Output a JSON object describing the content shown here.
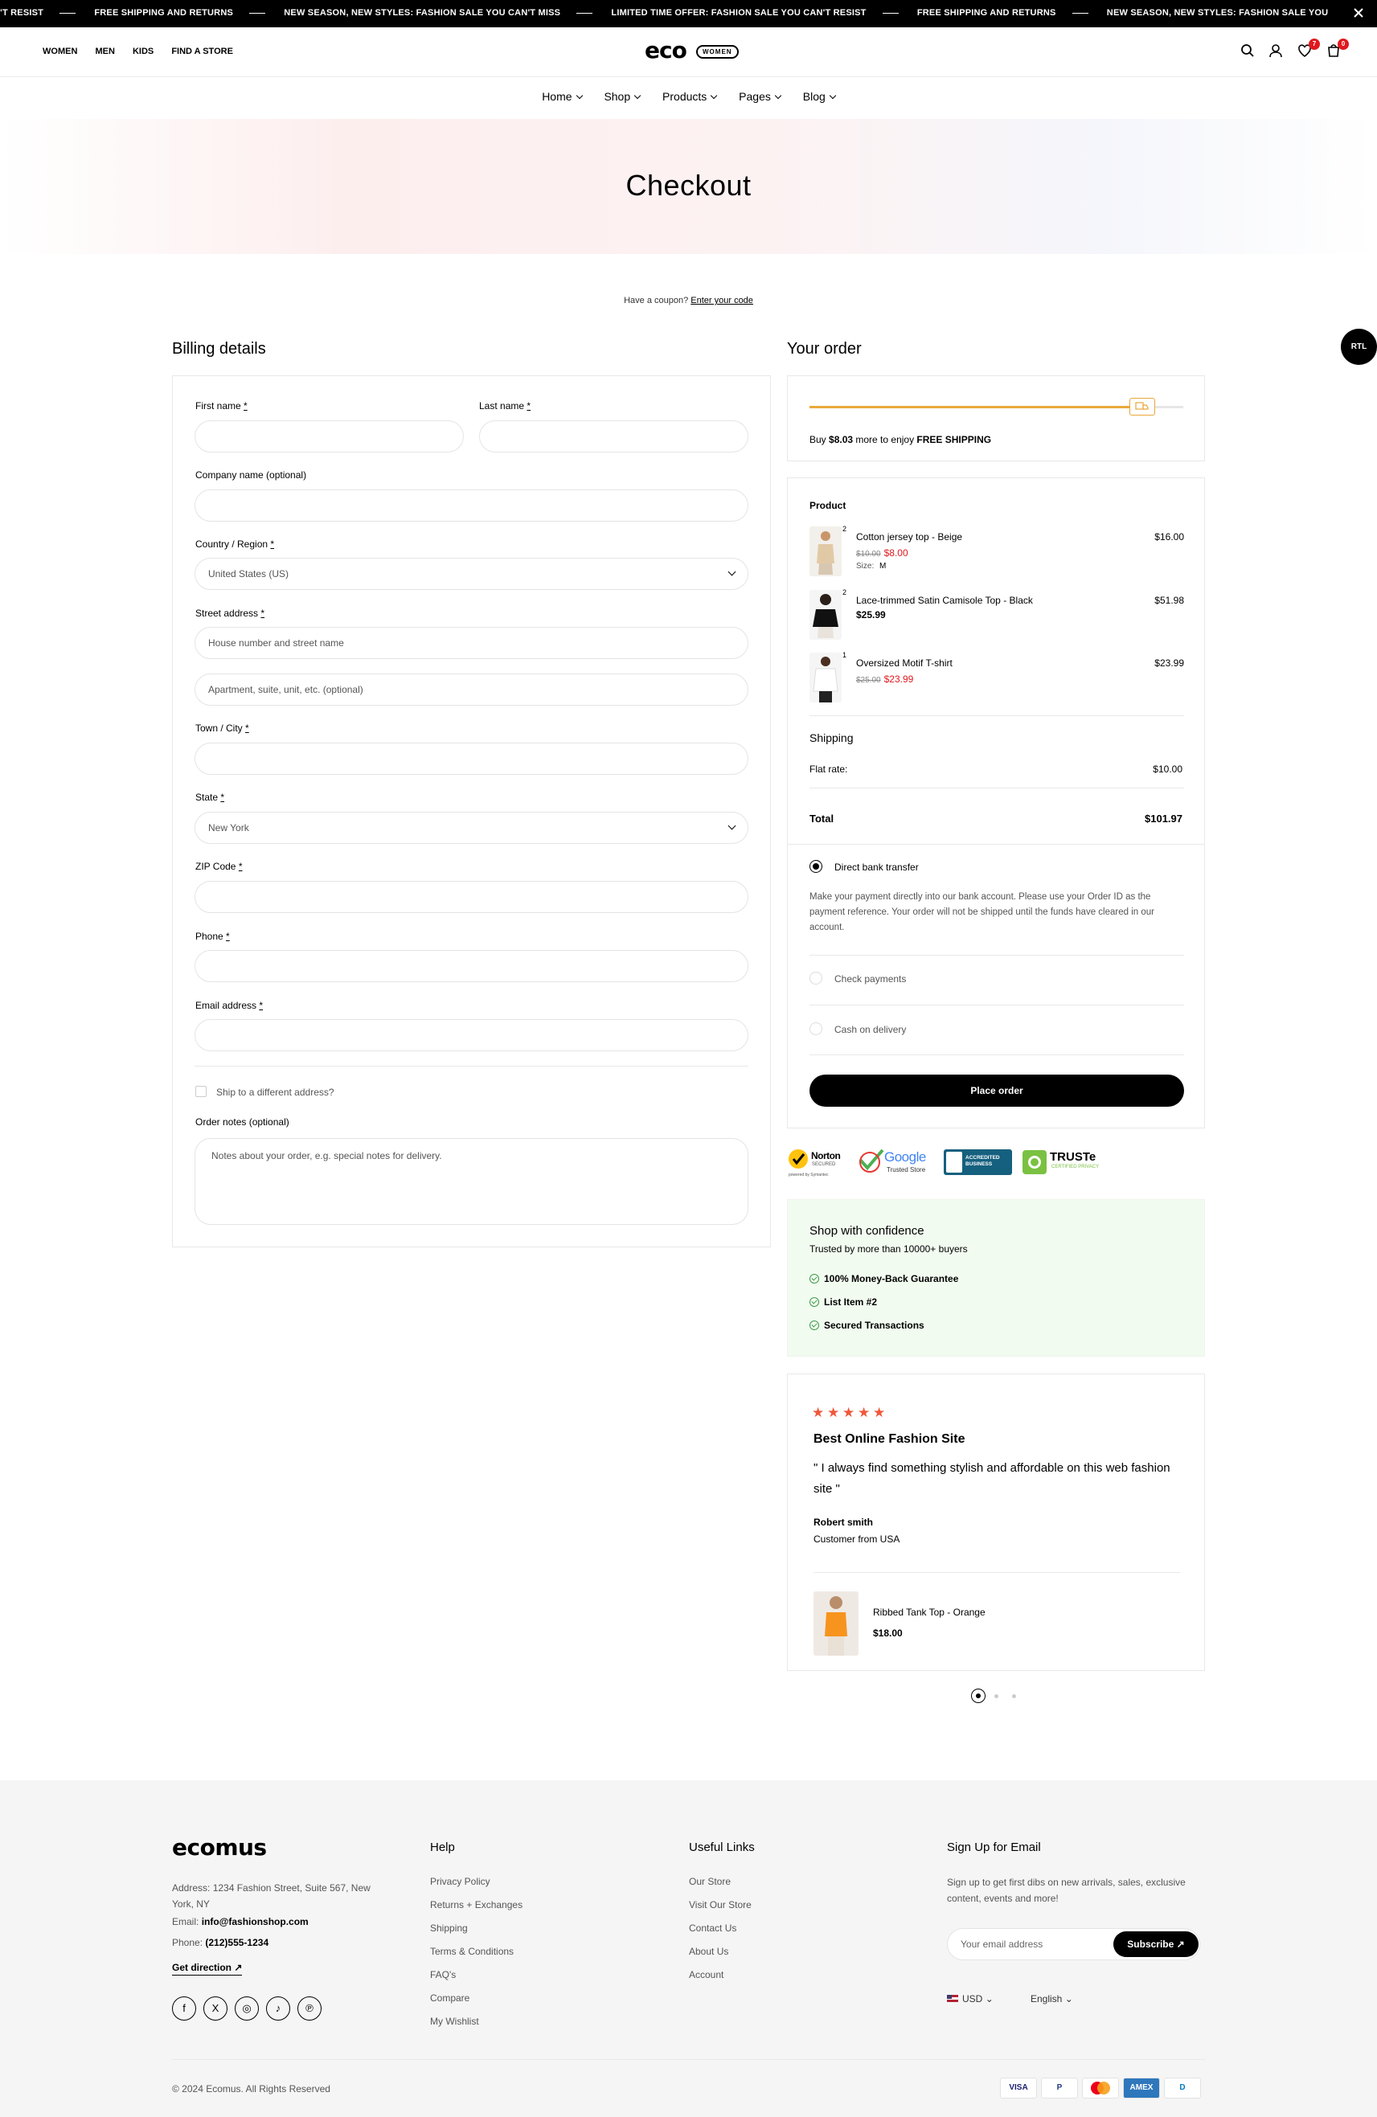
{
  "announcement": {
    "items": [
      "N'T RESIST",
      "FREE SHIPPING AND RETURNS",
      "NEW SEASON, NEW STYLES: FASHION SALE YOU CAN'T MISS",
      "LIMITED TIME OFFER: FASHION SALE YOU CAN'T RESIST",
      "FREE SHIPPING AND RETURNS",
      "NEW SEASON, NEW STYLES: FASHION SALE YOU"
    ],
    "close_icon": "close-icon"
  },
  "header": {
    "topnav": [
      "WOMEN",
      "MEN",
      "KIDS",
      "FIND A STORE"
    ],
    "logo_main": "eco",
    "logo_badge": "WOMEN",
    "wishlist_count": "7",
    "cart_count": "0"
  },
  "mainnav": [
    "Home",
    "Shop",
    "Products",
    "Pages",
    "Blog"
  ],
  "hero": {
    "title": "Checkout"
  },
  "coupon": {
    "text": "Have a coupon?",
    "link": "Enter your code"
  },
  "billing": {
    "title": "Billing details",
    "first_name": "First name",
    "last_name": "Last name",
    "company": "Company name (optional)",
    "country_label": "Country / Region",
    "country_value": "United States (US)",
    "street_label": "Street address",
    "street_placeholder": "House number and street name",
    "apt_placeholder": "Apartment, suite, unit, etc. (optional)",
    "city_label": "Town / City",
    "state_label": "State",
    "state_value": "New York",
    "zip_label": "ZIP Code",
    "phone_label": "Phone",
    "email_label": "Email address",
    "ship_different": "Ship to a different address?",
    "notes_label": "Order notes (optional)",
    "notes_placeholder": "Notes about your order, e.g. special notes for delivery.",
    "required_mark": "*"
  },
  "order": {
    "title": "Your order",
    "free_shipping": {
      "prefix": "Buy ",
      "amount": "$8.03",
      "middle": " more to enjoy ",
      "label": "FREE SHIPPING",
      "progress": 0.92
    },
    "product_header": "Product",
    "items": [
      {
        "qty": "2",
        "name": "Cotton jersey top - Beige",
        "old": "$10.00",
        "new": "$8.00",
        "size": "Size:",
        "size_value": "M",
        "total": "$16.00"
      },
      {
        "qty": "2",
        "name": "Lace-trimmed Satin Camisole Top - Black",
        "price": "$25.99",
        "total": "$51.98"
      },
      {
        "qty": "1",
        "name": "Oversized Motif T-shirt",
        "old": "$25.00",
        "new": "$23.99",
        "total": "$23.99"
      }
    ],
    "shipping_title": "Shipping",
    "flat_rate": "Flat rate:",
    "flat_rate_value": "$10.00",
    "total_label": "Total",
    "total_value": "$101.97",
    "payment": {
      "bank": "Direct bank transfer",
      "bank_desc": "Make your payment directly into our bank account. Please use your Order ID as the payment reference. Your order will not be shipped until the funds have cleared in our account.",
      "check": "Check payments",
      "cod": "Cash on delivery"
    },
    "place_order": "Place order"
  },
  "trust": {
    "norton": "Norton",
    "norton_sub": "SECURED",
    "norton_by": "powered by Symantec",
    "google": "Google",
    "google_sub": "Trusted Store",
    "bbb": "ACCREDITED BUSINESS",
    "truste": "TRUSTe",
    "truste_sub": "CERTIFIED PRIVACY"
  },
  "confidence": {
    "title": "Shop with confidence",
    "subtitle": "Trusted by more than 10000+ buyers",
    "items": [
      "100% Money-Back Guarantee",
      "List Item #2",
      "Secured Transactions"
    ]
  },
  "testimonial": {
    "rating": 5,
    "title": "Best Online Fashion Site",
    "quote": "\" I always find something stylish and affordable on this web fashion site \"",
    "author": "Robert smith",
    "role": "Customer from USA",
    "product_name": "Ribbed Tank Top - Orange",
    "product_price": "$18.00"
  },
  "rtl": "RTL",
  "footer": {
    "logo": "ecomus",
    "address": "Address: 1234 Fashion Street, Suite 567, New York, NY",
    "email_label": "Email:",
    "email": "info@fashionshop.com",
    "phone_label": "Phone:",
    "phone": "(212)555-1234",
    "direction": "Get direction",
    "help_title": "Help",
    "help_links": [
      "Privacy Policy",
      "Returns + Exchanges",
      "Shipping",
      "Terms & Conditions",
      "FAQ's",
      "Compare",
      "My Wishlist"
    ],
    "useful_title": "Useful Links",
    "useful_links": [
      "Our Store",
      "Visit Our Store",
      "Contact Us",
      "About Us",
      "Account"
    ],
    "signup_title": "Sign Up for Email",
    "signup_desc": "Sign up to get first dibs on new arrivals, sales, exclusive content, events and more!",
    "email_placeholder": "Your email address",
    "subscribe": "Subscribe",
    "currency": "USD",
    "language": "English",
    "copyright": "© 2024 Ecomus. All Rights Reserved",
    "payments": [
      "VISA",
      "P",
      "MC",
      "AMEX",
      "D"
    ]
  },
  "colors": {
    "accent": "#e8a83a",
    "sale": "#e0191f",
    "star": "#f0573a",
    "confidence_bg": "#f2fbf0",
    "check": "#3a9a47"
  }
}
